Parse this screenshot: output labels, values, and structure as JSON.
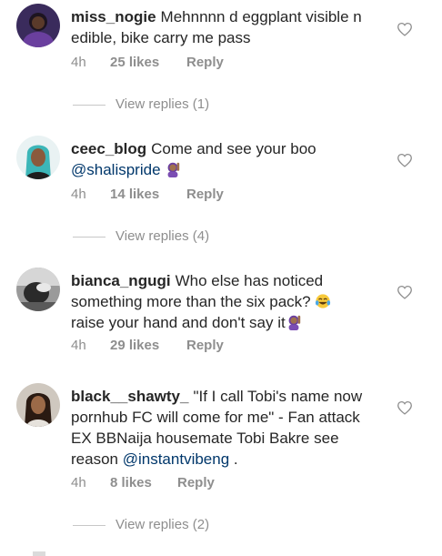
{
  "comments": [
    {
      "username": "miss_nogie",
      "text": "Mehnnnn d eggplant visible n edible, bike carry me pass",
      "time": "4h",
      "likes": "25 likes",
      "reply": "Reply",
      "view_replies": "View replies (1)",
      "avatar_icon": "avatar-woman-dark"
    },
    {
      "username": "ceec_blog",
      "text": "Come and see your boo",
      "mention": "@shalispride",
      "emoji": "woman-raising-hand",
      "time": "4h",
      "likes": "14 likes",
      "reply": "Reply",
      "view_replies": "View replies (4)",
      "avatar_icon": "avatar-woman-teal-hair"
    },
    {
      "username": "bianca_ngugi",
      "text": "Who else has noticed something more than the six pack?",
      "emoji1": "tears-of-joy",
      "text2": "raise your hand and don't say it",
      "emoji2": "woman-raising-hand",
      "time": "4h",
      "likes": "29 likes",
      "reply": "Reply",
      "avatar_icon": "avatar-bw-photo"
    },
    {
      "username": "black__shawty_",
      "text": "\"If I call Tobi's name now pornhub FC will come for me\" - Fan attack EX BBNaija housemate Tobi Bakre see reason",
      "mention": "@instantvibeng",
      "text_end": ".",
      "time": "4h",
      "likes": "8 likes",
      "reply": "Reply",
      "view_replies": "View replies (2)",
      "avatar_icon": "avatar-woman-brown"
    }
  ],
  "colors": {
    "text": "#262626",
    "meta": "#8e8e8e",
    "mention": "#00376b",
    "divider": "#c7c7c7"
  }
}
